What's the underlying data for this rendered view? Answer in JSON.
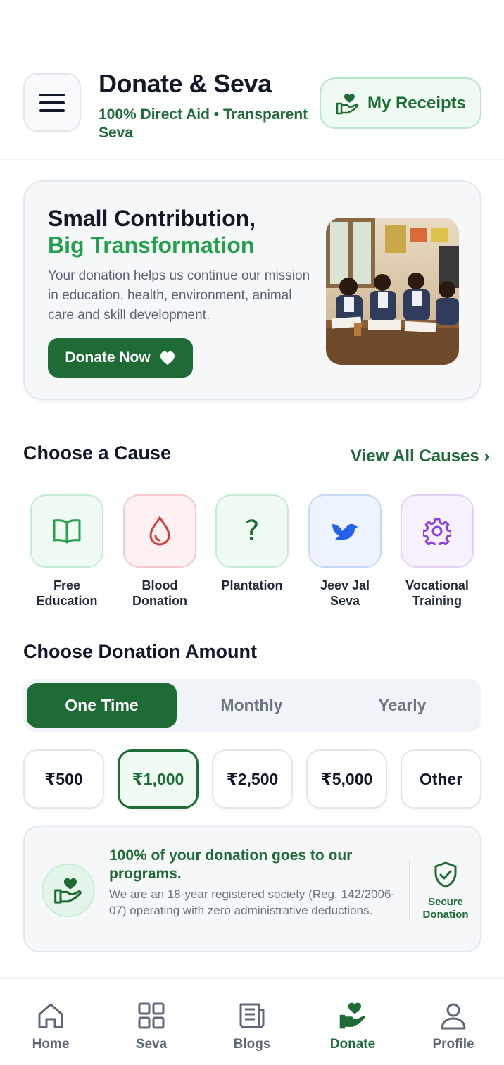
{
  "header": {
    "title": "Donate & Seva",
    "subtitle": "100% Direct Aid • Transparent Seva",
    "receipts_label": "My Receipts"
  },
  "hero": {
    "title_line1": "Small Contribution,",
    "title_line2": "Big Transformation",
    "description": "Your donation helps us continue our mission in education, health, environment, animal care and skill development.",
    "cta_label": "Donate Now"
  },
  "causes": {
    "title": "Choose a Cause",
    "view_all": "View All Causes ›",
    "items": [
      {
        "label": "Free Education",
        "icon": "book-icon",
        "color": "#22a04b"
      },
      {
        "label": "Blood Donation",
        "icon": "drop-icon",
        "color": "#d93a3a"
      },
      {
        "label": "Plantation",
        "icon": "question-icon",
        "color": "#1f6b37"
      },
      {
        "label": "Jeev Jal Seva",
        "icon": "bird-icon",
        "color": "#2563eb"
      },
      {
        "label": "Vocational Training",
        "icon": "gear-icon",
        "color": "#8b3fd9"
      }
    ]
  },
  "amount": {
    "title": "Choose Donation Amount",
    "frequencies": [
      "One Time",
      "Monthly",
      "Yearly"
    ],
    "selected_frequency": "One Time",
    "options": [
      "₹500",
      "₹1,000",
      "₹2,500",
      "₹5,000",
      "Other"
    ],
    "selected_option": "₹1,000"
  },
  "info": {
    "title": "100% of your donation goes to our programs.",
    "description": "We are an 18-year registered society (Reg. 142/2006-07) operating with zero administrative deductions.",
    "secure_label": "Secure Donation"
  },
  "nav": {
    "items": [
      {
        "label": "Home",
        "icon": "home-icon"
      },
      {
        "label": "Seva",
        "icon": "grid-icon"
      },
      {
        "label": "Blogs",
        "icon": "newspaper-icon"
      },
      {
        "label": "Donate",
        "icon": "donate-hand-icon"
      },
      {
        "label": "Profile",
        "icon": "user-icon"
      }
    ],
    "active": "Donate"
  },
  "colors": {
    "primary": "#1e6b35",
    "accent_green": "#22a04b"
  }
}
